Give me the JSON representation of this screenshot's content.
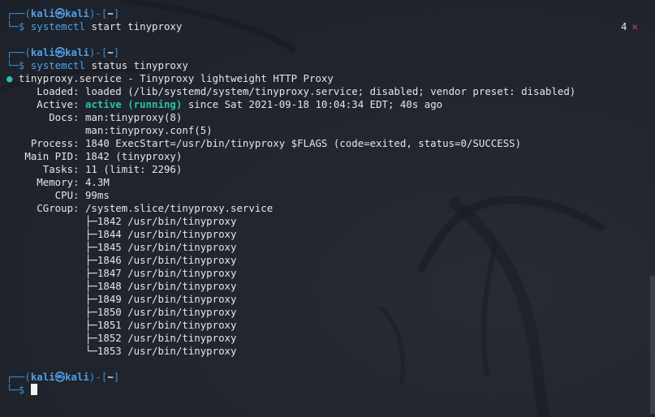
{
  "prompt": {
    "user": "kali",
    "at_symbol": "㉿",
    "host": "kali",
    "dir": "~"
  },
  "command1": {
    "cmd": "systemctl",
    "args": " start tinyproxy",
    "exit_code": "4",
    "exit_icon": "✕"
  },
  "command2": {
    "cmd": "systemctl",
    "args": " status tinyproxy"
  },
  "status": {
    "bullet": "●",
    "header": " tinyproxy.service - Tinyproxy lightweight HTTP Proxy",
    "loaded_label": "     Loaded:",
    "loaded_value": " loaded (/lib/systemd/system/tinyproxy.service; disabled; vendor preset: disabled)",
    "active_label": "     Active:",
    "active_state": " active (running)",
    "active_rest": " since Sat 2021-09-18 10:04:34 EDT; 40s ago",
    "docs_label": "       Docs:",
    "docs_value1": " man:tinyproxy(8)",
    "docs_value2": "             man:tinyproxy.conf(5)",
    "process_line": "    Process: 1840 ExecStart=/usr/bin/tinyproxy $FLAGS (code=exited, status=0/SUCCESS)",
    "mainpid_line": "   Main PID: 1842 (tinyproxy)",
    "tasks_line": "      Tasks: 11 (limit: 2296)",
    "memory_line": "     Memory: 4.3M",
    "cpu_line": "        CPU: 99ms",
    "cgroup_line": "     CGroup: /system.slice/tinyproxy.service",
    "cgroup_items": [
      "             ├─1842 /usr/bin/tinyproxy",
      "             ├─1844 /usr/bin/tinyproxy",
      "             ├─1845 /usr/bin/tinyproxy",
      "             ├─1846 /usr/bin/tinyproxy",
      "             ├─1847 /usr/bin/tinyproxy",
      "             ├─1848 /usr/bin/tinyproxy",
      "             ├─1849 /usr/bin/tinyproxy",
      "             ├─1850 /usr/bin/tinyproxy",
      "             ├─1851 /usr/bin/tinyproxy",
      "             ├─1852 /usr/bin/tinyproxy",
      "             └─1853 /usr/bin/tinyproxy"
    ]
  },
  "colors": {
    "background": "#21252e",
    "prompt_blue": "#3a8fd9",
    "active_green": "#27c3a6",
    "error_red": "#e0453a"
  }
}
